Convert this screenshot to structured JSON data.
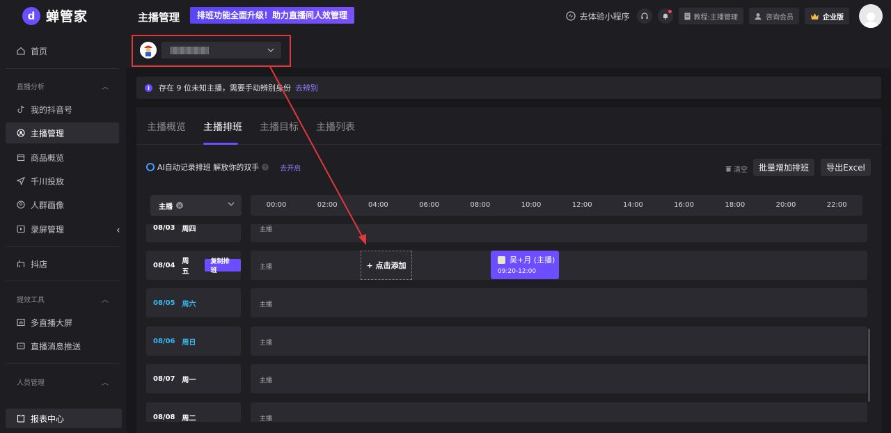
{
  "app": {
    "logo_text": "蝉管家",
    "page_title": "主播管理",
    "promo": "排班功能全面升级！助力直播间人效管理"
  },
  "header": {
    "mini_program": "去体验小程序",
    "tutorial": "教程:主播管理",
    "consult": "咨询会员",
    "edition": "企业版"
  },
  "sidebar": {
    "home": "首页",
    "group_live": "直播分析",
    "my_douyin": "我的抖音号",
    "host_mgmt": "主播管理",
    "goods": "商品概览",
    "qianchuan": "千川投放",
    "crowd": "人群画像",
    "record": "录屏管理",
    "shop": "抖店",
    "group_tools": "提效工具",
    "multi_screen": "多直播大屏",
    "push": "直播消息推送",
    "group_staff": "人员管理",
    "report": "报表中心"
  },
  "notice": {
    "text": "存在 9 位未知主播，需要手动辨别身份",
    "link": "去辨别"
  },
  "tabs": [
    "主播概览",
    "主播排班",
    "主播目标",
    "主播列表"
  ],
  "toolbar": {
    "ai_text": "AI自动记录排班 解放你的双手",
    "ai_link": "去开启",
    "clear": "清空",
    "batch_add": "批量增加排班",
    "export": "导出Excel"
  },
  "grid": {
    "filter_label": "主播",
    "times": [
      "00:00",
      "02:00",
      "04:00",
      "06:00",
      "08:00",
      "10:00",
      "12:00",
      "14:00",
      "16:00",
      "18:00",
      "20:00",
      "22:00"
    ]
  },
  "rows": [
    {
      "date": "08/03",
      "weekday": "周四",
      "label": "主播",
      "weekend": false
    },
    {
      "date": "08/04",
      "weekday": "周五",
      "label": "主播",
      "weekend": false,
      "copy": "复制排班",
      "add": "+ 点击添加",
      "shift": {
        "name": "吴+月 (主播)",
        "time": "09:20-12:00"
      }
    },
    {
      "date": "08/05",
      "weekday": "周六",
      "label": "主播",
      "weekend": true
    },
    {
      "date": "08/06",
      "weekday": "周日",
      "label": "主播",
      "weekend": true
    },
    {
      "date": "08/07",
      "weekday": "周一",
      "label": "主播",
      "weekend": false
    },
    {
      "date": "08/08",
      "weekday": "周二",
      "label": "主播",
      "weekend": false
    }
  ],
  "colors": {
    "accent": "#6c4dff",
    "weekend": "#36b8f0",
    "annotation": "#e0383b"
  }
}
